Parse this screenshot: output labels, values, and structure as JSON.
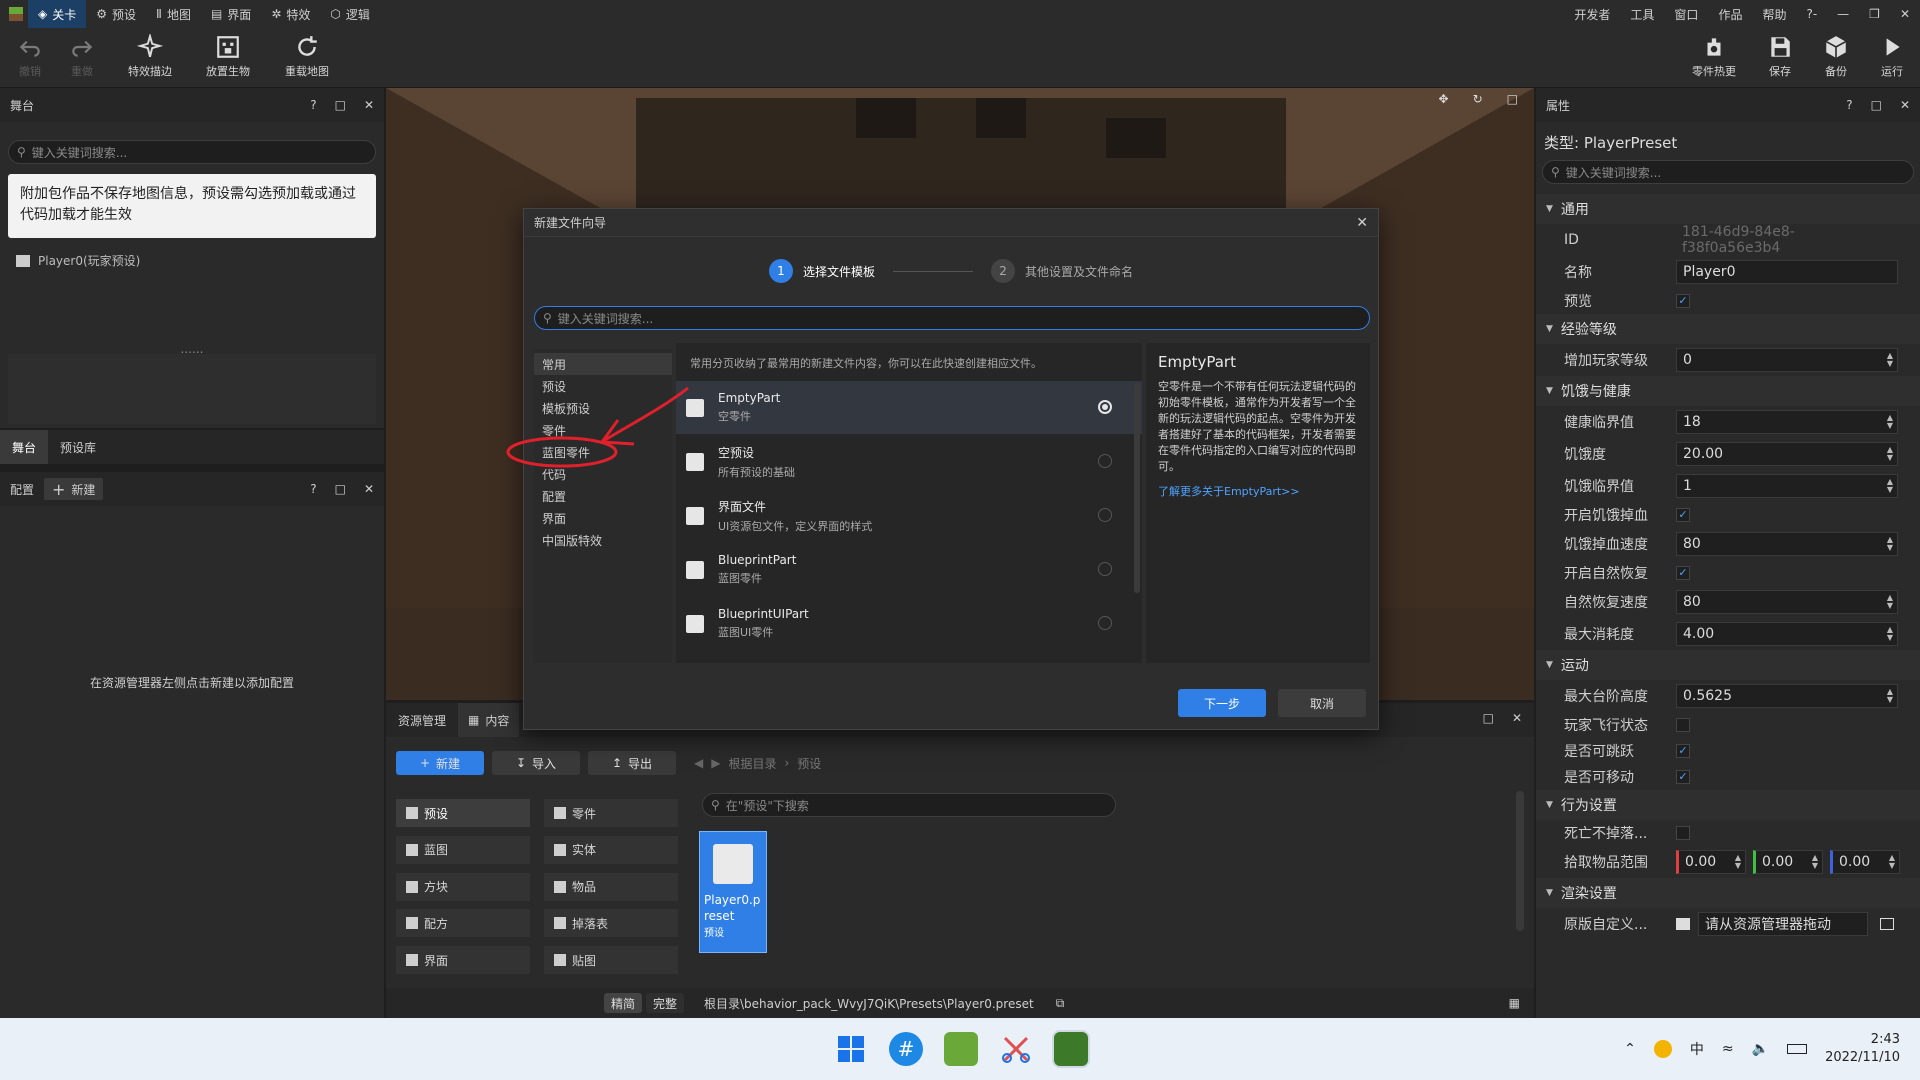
{
  "menubar": {
    "tabs": [
      {
        "label": "关卡",
        "icon": "diamond-icon",
        "active": true
      },
      {
        "label": "预设",
        "icon": "gear-icon"
      },
      {
        "label": "地图",
        "icon": "bars-icon"
      },
      {
        "label": "界面",
        "icon": "window-icon"
      },
      {
        "label": "特效",
        "icon": "effect-icon"
      },
      {
        "label": "逻辑",
        "icon": "logic-icon"
      }
    ],
    "right": [
      "开发者",
      "工具",
      "窗口",
      "作品",
      "帮助",
      "?-"
    ]
  },
  "toolbar": {
    "undo": "撤销",
    "redo": "重做",
    "effect_stroke": "特效描边",
    "place_creature": "放置生物",
    "reload_map": "重载地图",
    "part_hotreload": "零件热更",
    "save": "保存",
    "backup": "备份",
    "run": "运行"
  },
  "stage_panel": {
    "title": "舞台",
    "search_placeholder": "键入关键词搜索...",
    "notice": "附加包作品不保存地图信息，预设需勾选预加载或通过代码加载才能生效",
    "tree_item": "Player0(玩家预设)",
    "dots": "......",
    "tabs": [
      "舞台",
      "预设库"
    ]
  },
  "config_panel": {
    "title": "配置",
    "new_label": "新建",
    "empty_hint": "在资源管理器左侧点击新建以添加配置"
  },
  "dialog": {
    "title": "新建文件向导",
    "step1_num": "1",
    "step1_label": "选择文件模板",
    "step2_num": "2",
    "step2_label": "其他设置及文件命名",
    "search_placeholder": "键入关键词搜索...",
    "categories": [
      "常用",
      "预设",
      "模板预设",
      "零件",
      "蓝图零件",
      "代码",
      "配置",
      "界面",
      "中国版特效"
    ],
    "hint": "常用分页收纳了最常用的新建文件内容，你可以在此快速创建相应文件。",
    "templates": [
      {
        "name": "EmptyPart",
        "desc": "空零件",
        "icon": "puzzle-icon",
        "selected": true
      },
      {
        "name": "空预设",
        "desc": "所有预设的基础",
        "icon": "preset-icon",
        "selected": false
      },
      {
        "name": "界面文件",
        "desc": "UI资源包文件，定义界面的样式",
        "icon": "ui-file-icon",
        "selected": false
      },
      {
        "name": "BlueprintPart",
        "desc": "蓝图零件",
        "icon": "puzzle-icon",
        "selected": false
      },
      {
        "name": "BlueprintUIPart",
        "desc": "蓝图UI零件",
        "icon": "puzzle-icon",
        "selected": false
      }
    ],
    "detail_title": "EmptyPart",
    "detail_text": "空零件是一个不带有任何玩法逻辑代码的初始零件模板，通常作为开发者写一个全新的玩法逻辑代码的起点。空零件为开发者搭建好了基本的代码框架，开发者需要在零件代码指定的入口编写对应的代码即可。",
    "detail_link": "了解更多关于EmptyPart>>",
    "next": "下一步",
    "cancel": "取消"
  },
  "assets": {
    "title": "资源管理",
    "content_tab": "内容",
    "new": "新建",
    "import": "导入",
    "export": "导出",
    "breadcrumb_root": "根据目录",
    "breadcrumb_current": "预设",
    "search_placeholder": "在\"预设\"下搜索",
    "categories": [
      {
        "label": "预设",
        "active": true
      },
      {
        "label": "零件"
      },
      {
        "label": "蓝图"
      },
      {
        "label": "实体"
      },
      {
        "label": "方块"
      },
      {
        "label": "物品"
      },
      {
        "label": "配方"
      },
      {
        "label": "掉落表"
      },
      {
        "label": "界面"
      },
      {
        "label": "贴图"
      }
    ],
    "file_name": "Player0.preset",
    "file_type": "预设",
    "mode_simple": "精简",
    "mode_full": "完整",
    "path": "根目录\\behavior_pack_WvyJ7QiK\\Presets\\Player0.preset"
  },
  "props": {
    "title": "属性",
    "type_label": "类型:  PlayerPreset",
    "search_placeholder": "键入关键词搜索...",
    "sections": [
      {
        "title": "通用",
        "rows": [
          {
            "label": "ID",
            "value": "181-46d9-84e8-f38f0a56e3b4",
            "kind": "readonly"
          },
          {
            "label": "名称",
            "value": "Player0",
            "kind": "text"
          },
          {
            "label": "预览",
            "value": "✓",
            "kind": "check"
          }
        ]
      },
      {
        "title": "经验等级",
        "rows": [
          {
            "label": "增加玩家等级",
            "value": "0",
            "kind": "spin"
          }
        ]
      },
      {
        "title": "饥饿与健康",
        "rows": [
          {
            "label": "健康临界值",
            "value": "18",
            "kind": "spin"
          },
          {
            "label": "饥饿度",
            "value": "20.00",
            "kind": "spin"
          },
          {
            "label": "饥饿临界值",
            "value": "1",
            "kind": "spin"
          },
          {
            "label": "开启饥饿掉血",
            "value": "✓",
            "kind": "check"
          },
          {
            "label": "饥饿掉血速度",
            "value": "80",
            "kind": "spin"
          },
          {
            "label": "开启自然恢复",
            "value": "✓",
            "kind": "check"
          },
          {
            "label": "自然恢复速度",
            "value": "80",
            "kind": "spin"
          },
          {
            "label": "最大消耗度",
            "value": "4.00",
            "kind": "spin"
          }
        ]
      },
      {
        "title": "运动",
        "rows": [
          {
            "label": "最大台阶高度",
            "value": "0.5625",
            "kind": "spin"
          },
          {
            "label": "玩家飞行状态",
            "value": "",
            "kind": "check"
          },
          {
            "label": "是否可跳跃",
            "value": "✓",
            "kind": "check"
          },
          {
            "label": "是否可移动",
            "value": "✓",
            "kind": "check"
          }
        ]
      },
      {
        "title": "行为设置",
        "rows": [
          {
            "label": "死亡不掉落...",
            "value": "",
            "kind": "check"
          },
          {
            "label": "拾取物品范围",
            "value": "0.00|0.00|0.00",
            "kind": "vec3"
          }
        ]
      },
      {
        "title": "渲染设置",
        "rows": [
          {
            "label": "原版自定义...",
            "value": "请从资源管理器拖动",
            "kind": "drop"
          }
        ]
      }
    ]
  },
  "taskbar": {
    "ime": "中",
    "time": "2:43",
    "date": "2022/11/10"
  },
  "colors": {
    "accent": "#2f7fe6",
    "annotation_red": "#e0202a"
  }
}
